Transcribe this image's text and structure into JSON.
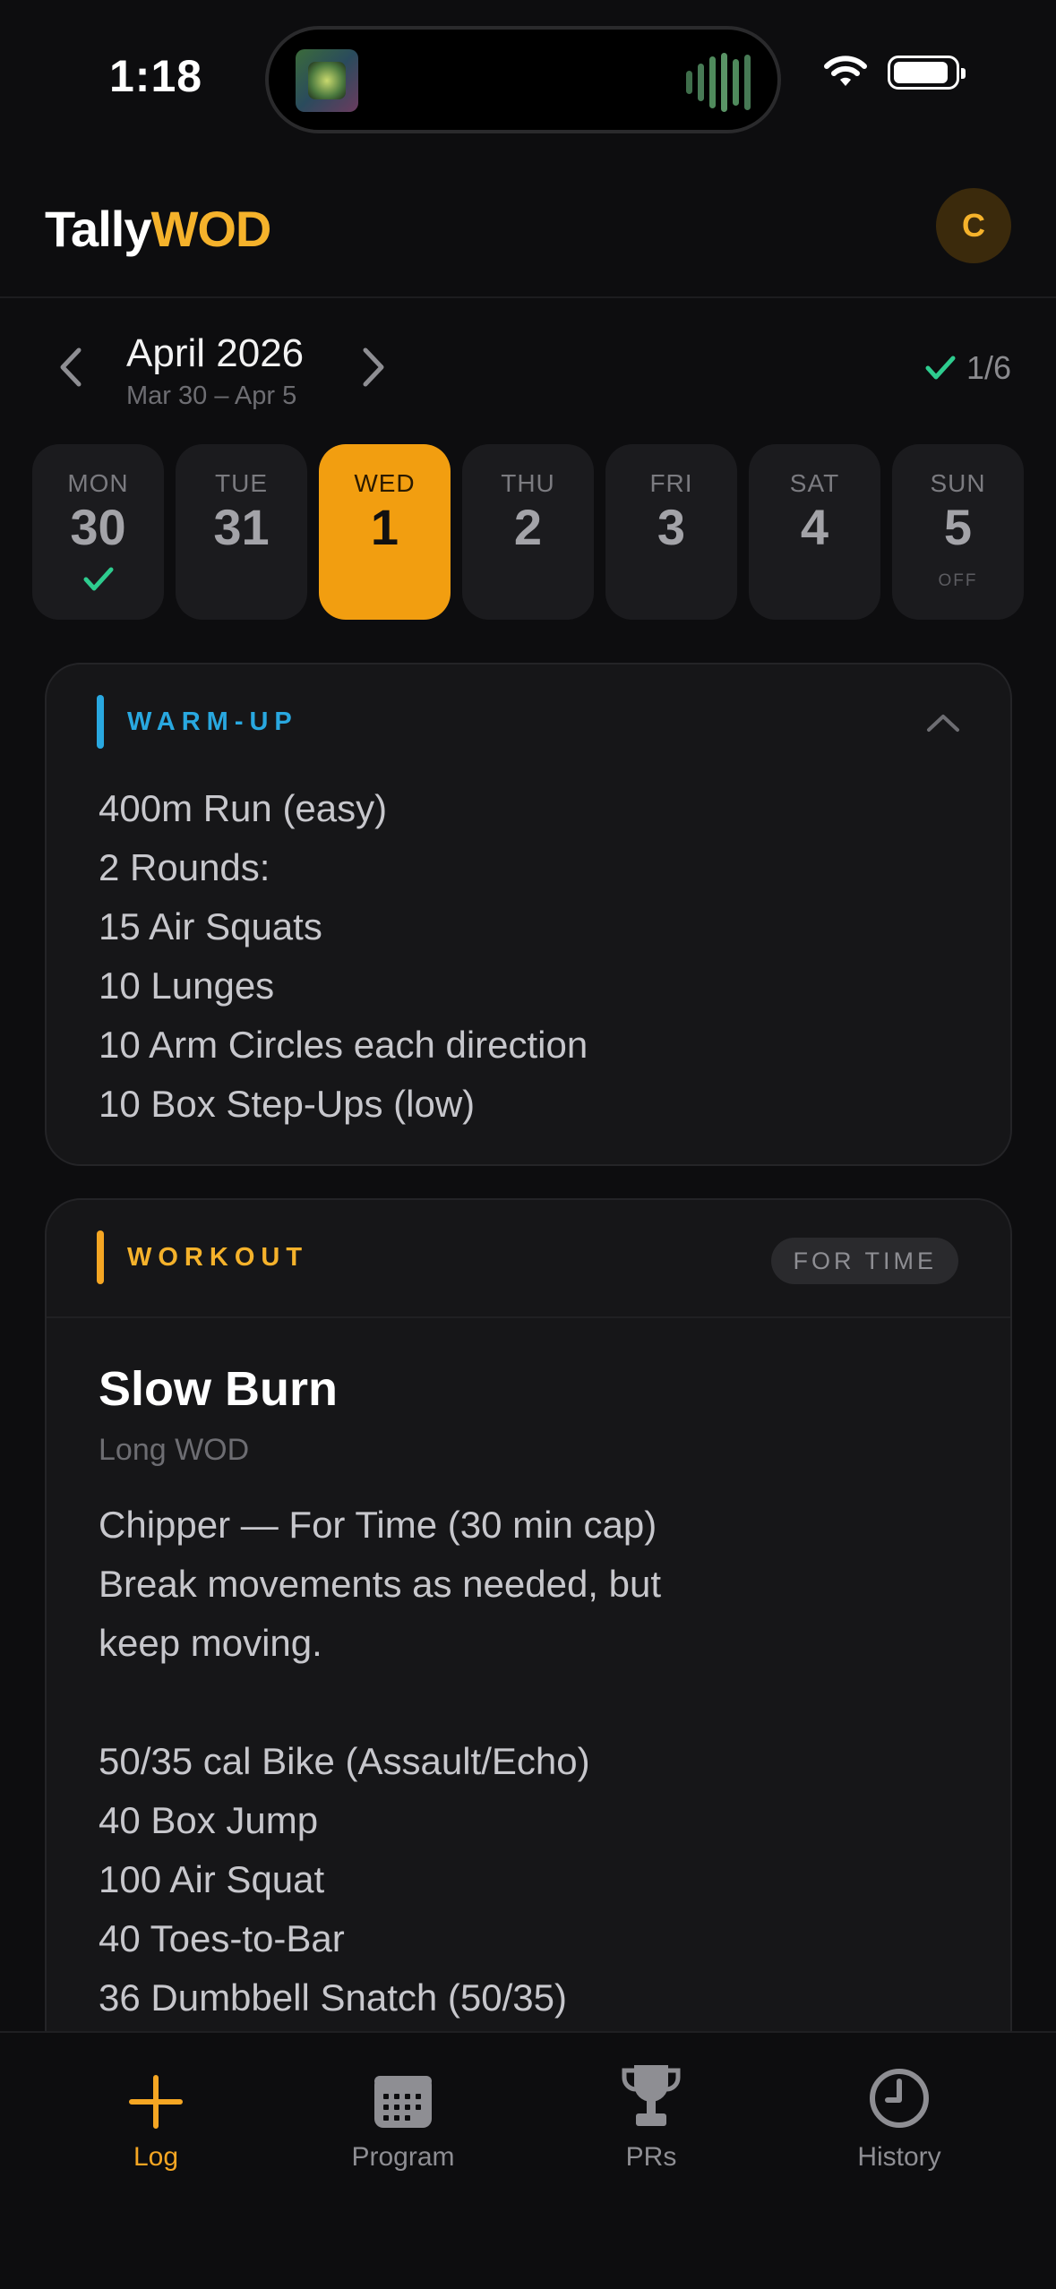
{
  "status_bar": {
    "time": "1:18",
    "icons": [
      "album-art-icon",
      "audio-waveform-icon",
      "wifi-icon",
      "battery-icon"
    ]
  },
  "header": {
    "brand_part1": "Tally",
    "brand_part2": "WOD",
    "avatar_initial": "C",
    "brand_color": "#f5b22b"
  },
  "week_nav": {
    "month": "April 2026",
    "range": "Mar 30 – Apr 5",
    "progress": "1/6"
  },
  "days": [
    {
      "name": "MON",
      "num": "30",
      "status": "done"
    },
    {
      "name": "TUE",
      "num": "31",
      "status": ""
    },
    {
      "name": "WED",
      "num": "1",
      "status": "selected"
    },
    {
      "name": "THU",
      "num": "2",
      "status": ""
    },
    {
      "name": "FRI",
      "num": "3",
      "status": ""
    },
    {
      "name": "SAT",
      "num": "4",
      "status": ""
    },
    {
      "name": "SUN",
      "num": "5",
      "status": "off",
      "status_label": "OFF"
    }
  ],
  "warmup": {
    "title": "WARM-UP",
    "accent": "#29a8e0",
    "lines": [
      "400m Run (easy)",
      "2 Rounds:",
      "15 Air Squats",
      "10 Lunges",
      "10 Arm Circles each direction",
      "10 Box Step-Ups (low)"
    ]
  },
  "workout": {
    "title": "WORKOUT",
    "accent": "#f5a623",
    "tag": "FOR TIME",
    "name": "Slow Burn",
    "subtitle": "Long WOD",
    "lines": [
      "Chipper — For Time (30 min cap)",
      "Break movements as needed, but",
      "keep moving.",
      "",
      "50/35 cal Bike (Assault/Echo)",
      "40 Box Jump",
      "100 Air Squat",
      "40 Toes-to-Bar",
      "36 Dumbbell Snatch (50/35)"
    ]
  },
  "tab_bar": {
    "tabs": [
      {
        "label": "Log",
        "icon": "plus-icon",
        "active": true
      },
      {
        "label": "Program",
        "icon": "calendar-icon",
        "active": false
      },
      {
        "label": "PRs",
        "icon": "trophy-icon",
        "active": false
      },
      {
        "label": "History",
        "icon": "clock-icon",
        "active": false
      }
    ]
  }
}
